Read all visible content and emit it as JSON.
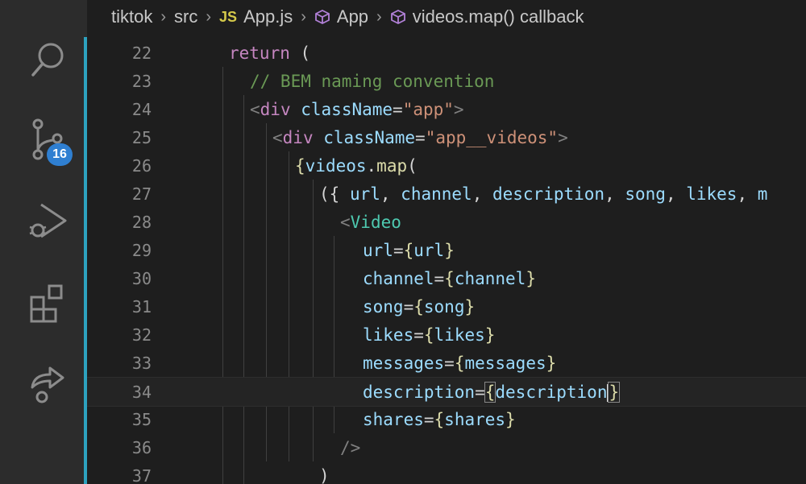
{
  "breadcrumb": {
    "items": [
      {
        "label": "tiktok",
        "icon": ""
      },
      {
        "label": "src",
        "icon": ""
      },
      {
        "label": "App.js",
        "icon": "JS"
      },
      {
        "label": "App",
        "icon": "cube-icon"
      },
      {
        "label": "videos.map() callback",
        "icon": "cube-icon"
      }
    ]
  },
  "activity_bar": {
    "icons": [
      "search-icon",
      "source-control-icon",
      "run-debug-icon",
      "extensions-icon",
      "live-share-icon"
    ],
    "source_control_badge": "16"
  },
  "editor": {
    "lines": [
      {
        "n": "22",
        "tokens": [
          [
            "kw",
            "return"
          ],
          [
            "pl",
            " ("
          ]
        ]
      },
      {
        "n": "23",
        "tokens": [
          [
            "cm",
            "// BEM naming convention"
          ]
        ]
      },
      {
        "n": "24",
        "tokens": [
          [
            "tag",
            "<"
          ],
          [
            "kw",
            "div"
          ],
          [
            "pl",
            " "
          ],
          [
            "attr",
            "className"
          ],
          [
            "pl",
            "="
          ],
          [
            "str",
            "\"app\""
          ],
          [
            "tag",
            ">"
          ]
        ]
      },
      {
        "n": "25",
        "tokens": [
          [
            "tag",
            "<"
          ],
          [
            "kw",
            "div"
          ],
          [
            "pl",
            " "
          ],
          [
            "attr",
            "className"
          ],
          [
            "pl",
            "="
          ],
          [
            "str",
            "\"app__videos\""
          ],
          [
            "tag",
            ">"
          ]
        ]
      },
      {
        "n": "26",
        "tokens": [
          [
            "br",
            "{"
          ],
          [
            "var",
            "videos"
          ],
          [
            "pl",
            "."
          ],
          [
            "fn",
            "map"
          ],
          [
            "pl",
            "("
          ]
        ]
      },
      {
        "n": "27",
        "tokens": [
          [
            "pl",
            "({ "
          ],
          [
            "var",
            "url"
          ],
          [
            "pl",
            ", "
          ],
          [
            "var",
            "channel"
          ],
          [
            "pl",
            ", "
          ],
          [
            "var",
            "description"
          ],
          [
            "pl",
            ", "
          ],
          [
            "var",
            "song"
          ],
          [
            "pl",
            ", "
          ],
          [
            "var",
            "likes"
          ],
          [
            "pl",
            ", "
          ],
          [
            "var",
            "m"
          ]
        ]
      },
      {
        "n": "28",
        "tokens": [
          [
            "tag",
            "<"
          ],
          [
            "comp",
            "Video"
          ]
        ]
      },
      {
        "n": "29",
        "tokens": [
          [
            "attr",
            "url"
          ],
          [
            "pl",
            "="
          ],
          [
            "br",
            "{"
          ],
          [
            "var",
            "url"
          ],
          [
            "br",
            "}"
          ]
        ]
      },
      {
        "n": "30",
        "tokens": [
          [
            "attr",
            "channel"
          ],
          [
            "pl",
            "="
          ],
          [
            "br",
            "{"
          ],
          [
            "var",
            "channel"
          ],
          [
            "br",
            "}"
          ]
        ]
      },
      {
        "n": "31",
        "tokens": [
          [
            "attr",
            "song"
          ],
          [
            "pl",
            "="
          ],
          [
            "br",
            "{"
          ],
          [
            "var",
            "song"
          ],
          [
            "br",
            "}"
          ]
        ]
      },
      {
        "n": "32",
        "tokens": [
          [
            "attr",
            "likes"
          ],
          [
            "pl",
            "="
          ],
          [
            "br",
            "{"
          ],
          [
            "var",
            "likes"
          ],
          [
            "br",
            "}"
          ]
        ]
      },
      {
        "n": "33",
        "tokens": [
          [
            "attr",
            "messages"
          ],
          [
            "pl",
            "="
          ],
          [
            "br",
            "{"
          ],
          [
            "var",
            "messages"
          ],
          [
            "br",
            "}"
          ]
        ]
      },
      {
        "n": "34",
        "tokens": [
          [
            "attr",
            "description"
          ],
          [
            "pl",
            "="
          ],
          [
            "brh",
            "{"
          ],
          [
            "var",
            "description"
          ],
          [
            "brh",
            "}"
          ]
        ]
      },
      {
        "n": "35",
        "tokens": [
          [
            "attr",
            "shares"
          ],
          [
            "pl",
            "="
          ],
          [
            "br",
            "{"
          ],
          [
            "var",
            "shares"
          ],
          [
            "br",
            "}"
          ]
        ]
      },
      {
        "n": "36",
        "tokens": [
          [
            "tag",
            "/>"
          ]
        ]
      },
      {
        "n": "37",
        "tokens": [
          [
            "pl",
            ")"
          ]
        ]
      }
    ]
  },
  "colors": {
    "background": "#1e1e1e",
    "activity_bar": "#2c2c2c",
    "badge": "#2f7fd1",
    "gutter_marker": "#2da2bf"
  }
}
